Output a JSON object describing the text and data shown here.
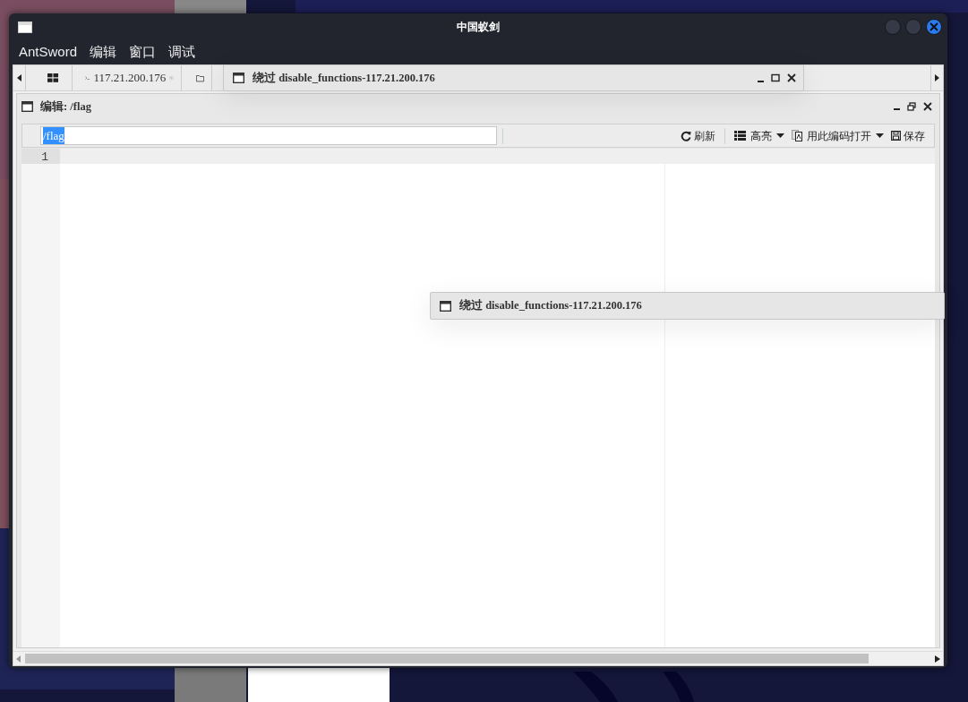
{
  "window": {
    "title": "中国蚁剑"
  },
  "menu": [
    "AntSword",
    "编辑",
    "窗口",
    "调试"
  ],
  "tabs": [
    {
      "kind": "home"
    },
    {
      "kind": "terminal",
      "label": "117.21.200.176",
      "closable": true
    },
    {
      "kind": "folder"
    }
  ],
  "editor": {
    "title": "编辑: /flag",
    "path": "/flag",
    "path_selected": true,
    "toolbar": [
      {
        "kind": "refresh",
        "label": "刷新",
        "dropdown": false,
        "separator_before": false
      },
      {
        "kind": "list",
        "label": "高亮",
        "dropdown": true,
        "separator_before": true
      },
      {
        "kind": "encoding",
        "label": "用此编码打开",
        "dropdown": true,
        "separator_before": false
      },
      {
        "kind": "save",
        "label": "保存",
        "dropdown": false,
        "separator_before": false
      }
    ],
    "line_numbers": [
      "1"
    ]
  },
  "floating_windows": [
    {
      "title": "绕过 disable_functions-117.21.200.176",
      "controls": true
    },
    {
      "title": "绕过 disable_functions-117.21.200.176",
      "controls": false
    }
  ]
}
